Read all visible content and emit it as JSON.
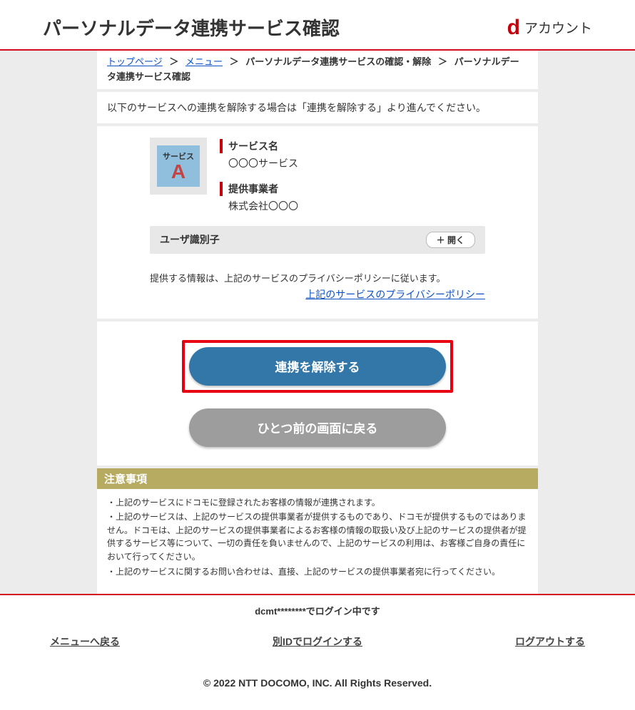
{
  "header": {
    "title": "パーソナルデータ連携サービス確認",
    "brand_letter": "d",
    "brand_text": "アカウント"
  },
  "breadcrumb": {
    "items": [
      {
        "label": "トップページ",
        "link": true
      },
      {
        "label": "メニュー",
        "link": true
      },
      {
        "label": "パーソナルデータ連携サービスの確認・解除",
        "link": false
      },
      {
        "label": "パーソナルデータ連携サービス確認",
        "link": false
      }
    ],
    "separator": "＞"
  },
  "instruction": "以下のサービスへの連携を解除する場合は「連携を解除する」より進んでください。",
  "service": {
    "icon_small": "サービス",
    "icon_letter": "A",
    "name_label": "サービス名",
    "name_value": "〇〇〇サービス",
    "provider_label": "提供事業者",
    "provider_value": "株式会社〇〇〇"
  },
  "uid_bar": {
    "label": "ユーザ識別子",
    "expand": "＋ 開く"
  },
  "panel_note": "提供する情報は、上記のサービスのプライバシーポリシーに従います。",
  "privacy_link": "上記のサービスのプライバシーポリシー",
  "buttons": {
    "remove": "連携を解除する",
    "back": "ひとつ前の画面に戻る"
  },
  "notes": {
    "heading": "注意事項",
    "bullets": [
      "・上記のサービスにドコモに登録されたお客様の情報が連携されます。",
      "・上記のサービスは、上記のサービスの提供事業者が提供するものであり、ドコモが提供するものではありません。ドコモは、上記のサービスの提供事業者によるお客様の情報の取扱い及び上記のサービスの提供者が提供するサービス等について、一切の責任を負いませんので、上記のサービスの利用は、お客様ご自身の責任において行ってください。",
      "・上記のサービスに関するお問い合わせは、直接、上記のサービスの提供事業者宛に行ってください。"
    ]
  },
  "footer": {
    "login_status": "dcmt********でログイン中です",
    "links": {
      "menu": "メニューへ戻る",
      "other_id": "別IDでログインする",
      "logout": "ログアウトする"
    },
    "copyright": "© 2022 NTT DOCOMO, INC. All Rights Reserved."
  }
}
